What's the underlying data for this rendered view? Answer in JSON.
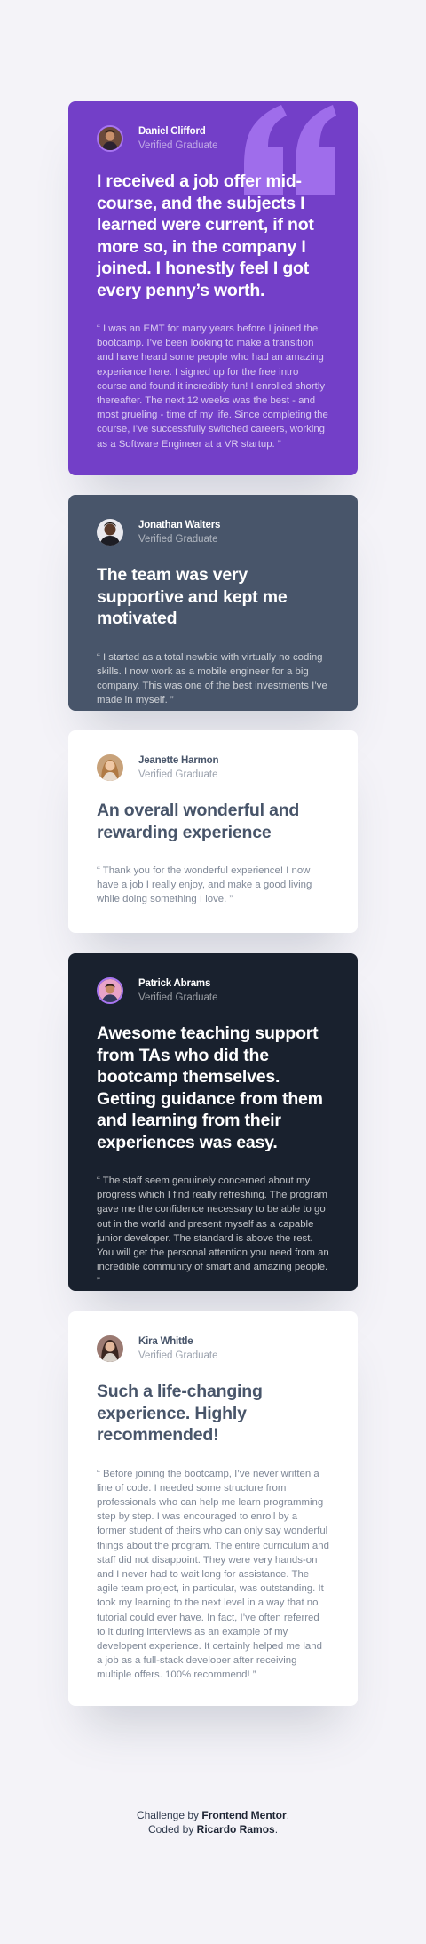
{
  "testimonials": [
    {
      "name": "Daniel Clifford",
      "badge": "Verified Graduate",
      "title": "I received a job offer mid-course, and the subjects I learned were current, if not more so, in the company I joined. I honestly feel I got every penny’s worth.",
      "body": "“ I was an EMT for many years before I joined the bootcamp. I’ve been looking to make a transition and have heard some people who had an amazing experience here. I signed up for the free intro course and found it incredibly fun! I enrolled shortly thereafter. The next 12 weeks was the best - and most grueling - time of my life. Since completing the course, I’ve successfully switched careers, working as a Software Engineer at a VR startup. ”",
      "card_color": "#733fc8",
      "avatar_ring_color": "#a775f1",
      "decoration_icon": "quotation-mark-icon"
    },
    {
      "name": "Jonathan Walters",
      "badge": "Verified Graduate",
      "title": "The team was very supportive and kept me motivated",
      "body": "“ I started as a total newbie with virtually no coding skills. I now work as a mobile engineer for a big company. This was one of the best investments I’ve made in myself. ”",
      "card_color": "#48556a"
    },
    {
      "name": "Jeanette Harmon",
      "badge": "Verified Graduate",
      "title": "An overall wonderful and rewarding experience",
      "body": "“ Thank you for the wonderful experience! I now have a job I really enjoy, and make a good living while doing something I love. ”",
      "card_color": "#ffffff"
    },
    {
      "name": "Patrick Abrams",
      "badge": "Verified Graduate",
      "title": "Awesome teaching support from TAs who did the bootcamp themselves. Getting guidance from them and learning from their experiences was easy.",
      "body": "“ The staff seem genuinely concerned about my progress which I find really refreshing. The program gave me the confidence necessary to be able to go out in the world and present myself as a capable junior developer. The standard is above the rest. You will get the personal attention you need from an incredible community of smart and amazing people. ”",
      "card_color": "#19212e",
      "avatar_ring_color": "#a775f1"
    },
    {
      "name": "Kira Whittle",
      "badge": "Verified Graduate",
      "title": "Such a life-changing experience. Highly recommended!",
      "body": "“ Before joining the bootcamp, I’ve never written a line of code. I needed some structure from professionals who can help me learn programming step by step. I was encouraged to enroll by a former student of theirs who can only say wonderful things about the program. The entire curriculum and staff did not disappoint. They were very hands-on and I never had to wait long for assistance. The agile team project, in particular, was outstanding. It took my learning to the next level in a way that no tutorial could ever have. In fact, I’ve often referred to it during interviews as an example of my developent experience. It certainly helped me land a job as a full-stack developer after receiving multiple offers. 100% recommend! ”",
      "card_color": "#ffffff"
    }
  ],
  "footer": {
    "challenge_prefix": "Challenge by",
    "challenge_link": "Frontend Mentor",
    "challenge_suffix": ".",
    "coded_prefix": "Coded by",
    "coded_link": "Ricardo Ramos",
    "coded_suffix": "."
  }
}
